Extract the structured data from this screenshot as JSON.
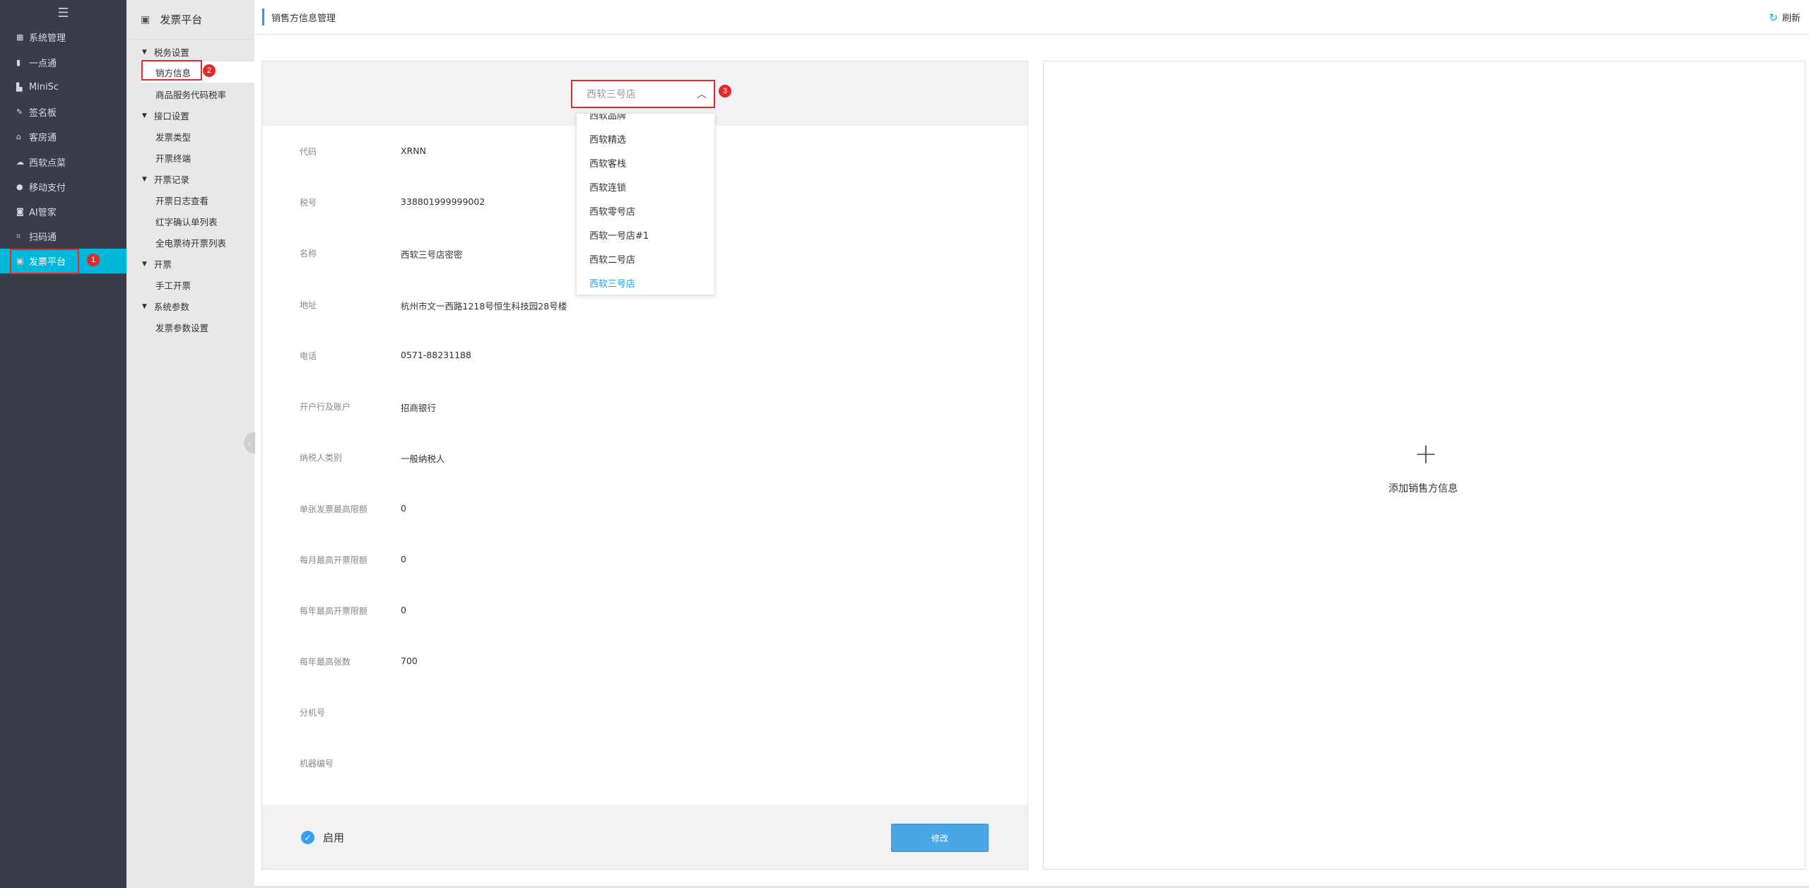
{
  "nav": {
    "menu_icon": "hamburger-icon",
    "items": [
      {
        "label": "系统管理",
        "icon": "grid-icon"
      },
      {
        "label": "一点通",
        "icon": "bar-chart-icon"
      },
      {
        "label": "MiniSc",
        "icon": "chart-icon"
      },
      {
        "label": "签名板",
        "icon": "pen-icon"
      },
      {
        "label": "客房通",
        "icon": "home-icon"
      },
      {
        "label": "西软点菜",
        "icon": "cloud-icon"
      },
      {
        "label": "移动支付",
        "icon": "pay-icon"
      },
      {
        "label": "AI管家",
        "icon": "robot-icon"
      },
      {
        "label": "扫码通",
        "icon": "scan-icon"
      },
      {
        "label": "发票平台",
        "icon": "invoice-icon"
      }
    ],
    "active_index": 9
  },
  "annotations": {
    "step1": "1",
    "step2": "2",
    "step3": "3"
  },
  "submenu": {
    "title": "发票平台",
    "groups": [
      {
        "label": "税务设置",
        "items": [
          "销方信息",
          "商品服务代码税率"
        ]
      },
      {
        "label": "接口设置",
        "items": [
          "发票类型",
          "开票终端"
        ]
      },
      {
        "label": "开票记录",
        "items": [
          "开票日志查看",
          "红字确认单列表",
          "全电票待开票列表"
        ]
      },
      {
        "label": "开票",
        "items": [
          "手工开票"
        ]
      },
      {
        "label": "系统参数",
        "items": [
          "发票参数设置"
        ]
      }
    ]
  },
  "header": {
    "title": "销售方信息管理",
    "refresh_label": "刷新"
  },
  "seller_card": {
    "selected_store": "西软三号店",
    "fields": [
      {
        "label": "代码",
        "value": "XRNN"
      },
      {
        "label": "税号",
        "value": "338801999999002"
      },
      {
        "label": "名称",
        "value": "西软三号店密密"
      },
      {
        "label": "地址",
        "value": "杭州市文一西路1218号恒生科技园28号楼"
      },
      {
        "label": "电话",
        "value": "0571-88231188"
      },
      {
        "label": "开户行及账户",
        "value": "招商银行"
      },
      {
        "label": "纳税人类别",
        "value": "一般纳税人"
      },
      {
        "label": "单张发票最高限额",
        "value": "0"
      },
      {
        "label": "每月最高开票限额",
        "value": "0"
      },
      {
        "label": "每年最高开票限额",
        "value": "0"
      },
      {
        "label": "每年最高张数",
        "value": "700"
      },
      {
        "label": "分机号",
        "value": ""
      },
      {
        "label": "机器编号",
        "value": ""
      }
    ],
    "enable_label": "启用",
    "edit_button": "修改"
  },
  "dropdown": {
    "options": [
      "西软品牌",
      "西软精选",
      "西软客栈",
      "西软连锁",
      "西软零号店",
      "西软一号店#1",
      "西软二号店",
      "西软三号店"
    ],
    "selected": "西软三号店"
  },
  "add_card": {
    "label": "添加销售方信息"
  }
}
